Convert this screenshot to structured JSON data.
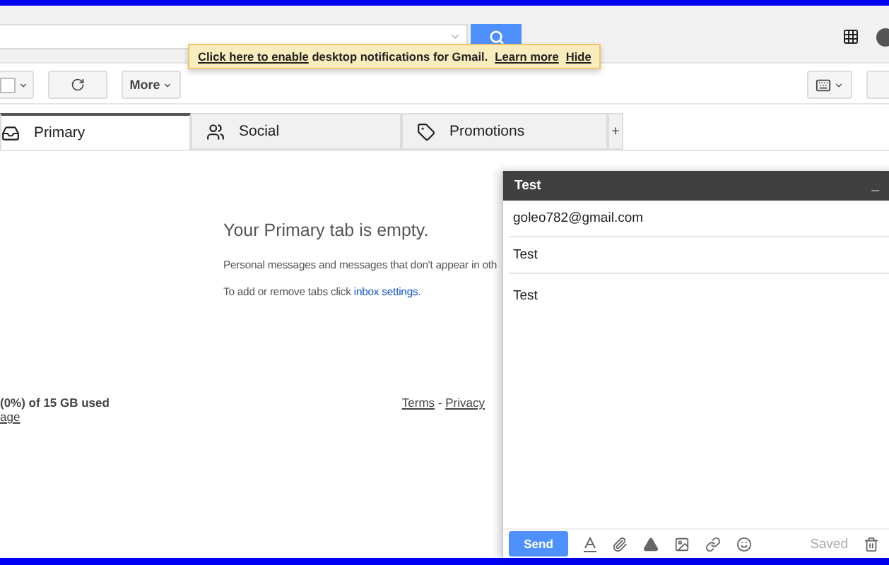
{
  "notification": {
    "link": "Click here to enable",
    "text": "desktop notifications for Gmail.",
    "learn_more": "Learn more",
    "hide": "Hide"
  },
  "toolbar": {
    "select_checked": false,
    "more": "More"
  },
  "tabs": [
    {
      "label": "Primary",
      "selected": true,
      "kind": "inbox"
    },
    {
      "label": "Social",
      "selected": false,
      "kind": "people"
    },
    {
      "label": "Promotions",
      "selected": false,
      "kind": "tag"
    }
  ],
  "add_tab": "+",
  "empty": {
    "title": "Your Primary tab is empty.",
    "line": "Personal messages and messages that don't appear in oth",
    "settings_prefix": "To add or remove tabs click",
    "settings_link": "inbox settings."
  },
  "footer": {
    "storage": "(0%) of 15 GB used",
    "manage": "age",
    "terms": "Terms",
    "separator": "-",
    "privacy": "Privacy"
  },
  "compose": {
    "title": "Test",
    "minimize": "_",
    "to": "goleo782@gmail.com",
    "subject": "Test",
    "body": "Test",
    "send": "Send",
    "status": "Saved"
  }
}
